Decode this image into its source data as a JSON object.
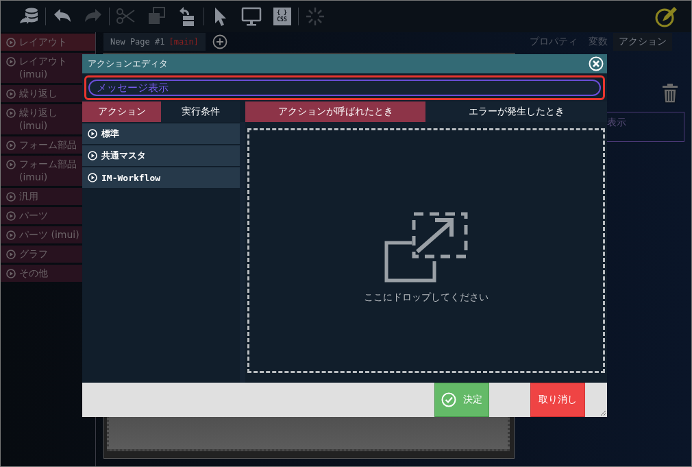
{
  "toolbar": {
    "groups": [
      {
        "items": [
          {
            "kind": "database",
            "disabled": false
          }
        ]
      },
      {
        "items": [
          {
            "kind": "undo",
            "disabled": false
          },
          {
            "kind": "redo",
            "disabled": true
          }
        ]
      },
      {
        "items": [
          {
            "kind": "cut",
            "disabled": true
          },
          {
            "kind": "copy",
            "disabled": true
          },
          {
            "kind": "tree",
            "disabled": false
          }
        ]
      },
      {
        "items": [
          {
            "kind": "pointer",
            "disabled": false
          },
          {
            "kind": "monitor",
            "disabled": false
          },
          {
            "kind": "css",
            "disabled": false,
            "glyph": "{ }",
            "label": "CSS"
          }
        ]
      },
      {
        "items": [
          {
            "kind": "spinner",
            "disabled": true
          }
        ]
      }
    ]
  },
  "sidebar": {
    "items": [
      {
        "label": "レイアウト",
        "selected": true
      },
      {
        "label": "レイアウト (imui)",
        "selected": false
      },
      {
        "label": "繰り返し",
        "selected": false
      },
      {
        "label": "繰り返し (imui)",
        "selected": false
      },
      {
        "label": "フォーム部品",
        "selected": false
      },
      {
        "label": "フォーム部品 (imui)",
        "selected": false
      },
      {
        "label": "汎用",
        "selected": false
      },
      {
        "label": "パーツ",
        "selected": false
      },
      {
        "label": "パーツ (imui)",
        "selected": false
      },
      {
        "label": "グラフ",
        "selected": false
      },
      {
        "label": "その他",
        "selected": false
      }
    ]
  },
  "canvas": {
    "tabs": [
      {
        "title": "New Page #1",
        "tag": "[main]",
        "selected": true
      }
    ]
  },
  "right_panel": {
    "tabs": [
      {
        "label": "プロパティ",
        "selected": false
      },
      {
        "label": "変数",
        "selected": false
      },
      {
        "label": "アクション",
        "selected": true
      }
    ],
    "action_item": {
      "label": "表示"
    }
  },
  "dialog": {
    "title": "アクションエディタ",
    "search": {
      "value": "メッセージ表示",
      "highlighted": true
    },
    "left_tabs": [
      {
        "label": "アクション",
        "selected": true
      },
      {
        "label": "実行条件",
        "selected": false
      }
    ],
    "right_tabs": [
      {
        "label": "アクションが呼ばれたとき",
        "selected": true
      },
      {
        "label": "エラーが発生したとき",
        "selected": false
      }
    ],
    "categories": [
      {
        "label": "標準"
      },
      {
        "label": "共通マスタ"
      },
      {
        "label": "IM-Workflow"
      }
    ],
    "drop_zone": {
      "hint": "ここにドロップしてください"
    },
    "buttons": [
      {
        "kind": "confirm",
        "label": "決定"
      },
      {
        "kind": "cancel",
        "label": "取り消し"
      }
    ]
  }
}
